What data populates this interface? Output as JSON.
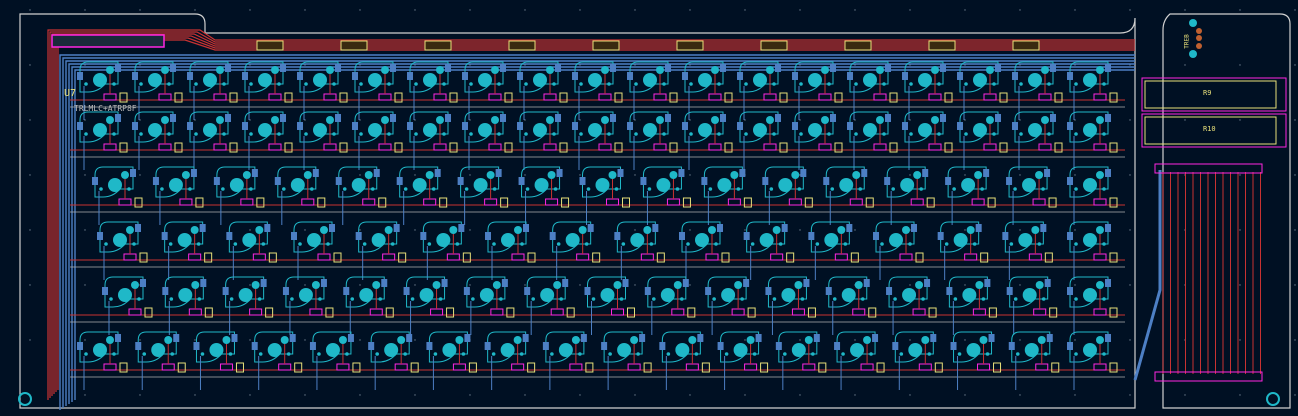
{
  "board": {
    "mcu_ref": "U7",
    "mcu_text": "TRLMLC+ATRP8F",
    "right_board": {
      "resistors": [
        "R9",
        "R10"
      ],
      "connector_ref": "TREB"
    }
  },
  "colors": {
    "background": "#001023",
    "front_copper": "#c83232",
    "back_copper": "#4d7fc4",
    "pads": "#1fb8c8",
    "silkscreen": "#e8e07a",
    "courtyard": "#ff26e2",
    "edge_cuts": "#d0d0d0"
  },
  "layout": {
    "rows": [
      19,
      19,
      17,
      16,
      17,
      18
    ]
  }
}
